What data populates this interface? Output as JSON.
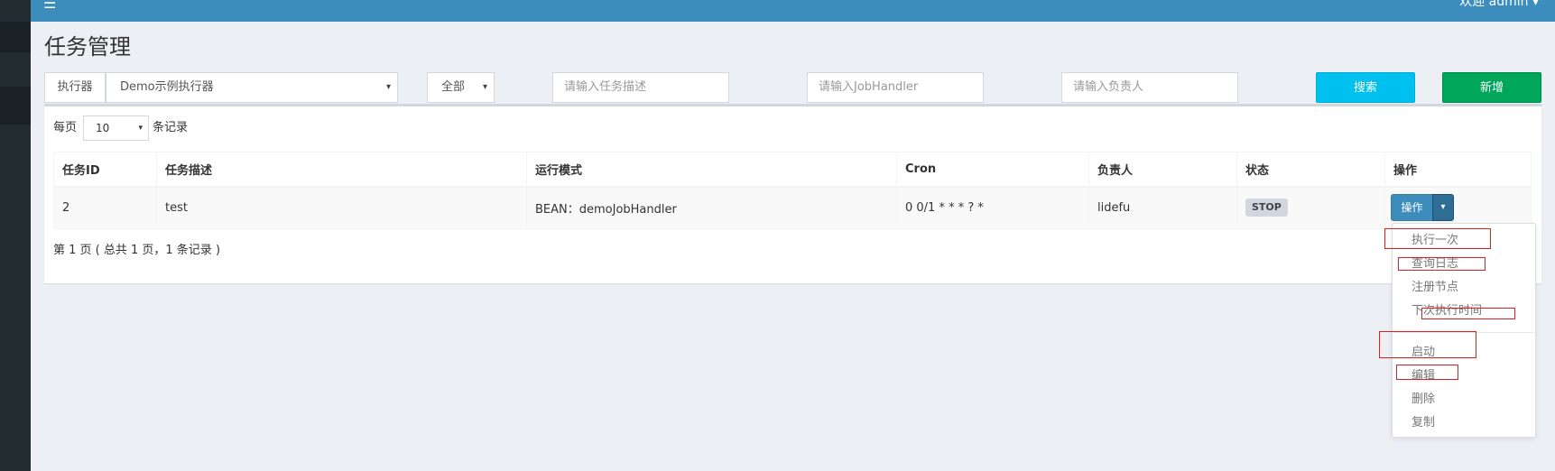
{
  "header": {
    "menu_icon": "hamburger-icon",
    "user_label": "欢迎 admin",
    "user_caret": "▾"
  },
  "page": {
    "title": "任务管理"
  },
  "filters": {
    "executor_label": "执行器",
    "executor_value": "Demo示例执行器",
    "status_value": "全部",
    "desc_placeholder": "请输入任务描述",
    "handler_placeholder": "请输入JobHandler",
    "author_placeholder": "请输入负责人",
    "search_label": "搜索",
    "add_label": "新增",
    "caret": "▾"
  },
  "perpage": {
    "prefix": "每页",
    "value": "10",
    "suffix": "条记录"
  },
  "table": {
    "columns": [
      "任务ID",
      "任务描述",
      "运行模式",
      "Cron",
      "负责人",
      "状态",
      "操作"
    ],
    "rows": [
      {
        "id": "2",
        "desc": "test",
        "mode": "BEAN：demoJobHandler",
        "cron": "0 0/1 * * * ? *",
        "author": "lidefu",
        "status": "STOP",
        "action": "操作"
      }
    ]
  },
  "pagination": {
    "info": "第 1 页 ( 总共 1 页，1 条记录 )"
  },
  "dropdown": {
    "items": [
      "执行一次",
      "查询日志",
      "注册节点",
      "下次执行时间",
      "启动",
      "编辑",
      "删除",
      "复制"
    ]
  },
  "colors": {
    "topbar": "#3c8dbc",
    "sidebar": "#222d32",
    "search_btn": "#00c0ef",
    "add_btn": "#00a65a",
    "annotation": "#e02020"
  }
}
